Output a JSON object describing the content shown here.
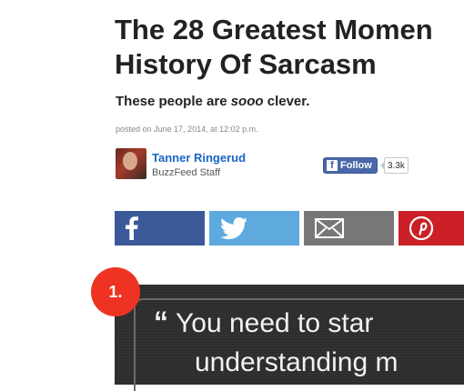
{
  "article": {
    "title_line1": "The 28 Greatest Momen",
    "title_line2": "History Of Sarcasm",
    "subtitle_before": "These people are ",
    "subtitle_emphasis": "sooo",
    "subtitle_after": " clever.",
    "posted": "posted on June 17, 2014, at 12:02 p.m."
  },
  "author": {
    "name": "Tanner Ringerud",
    "role": "BuzzFeed Staff"
  },
  "follow": {
    "logo": "f",
    "label": "Follow",
    "count": "3.3k"
  },
  "share": {
    "facebook_icon": "facebook-icon",
    "twitter_icon": "twitter-icon",
    "email_icon": "email-icon",
    "pinterest_icon": "pinterest-icon",
    "colors": {
      "facebook": "#3b5998",
      "twitter": "#5ea9dd",
      "email": "#777777",
      "pinterest": "#cb2027"
    }
  },
  "item": {
    "number": "1.",
    "quote_mark": "“",
    "quote_line1": "You need to star",
    "quote_line2": "understanding m"
  }
}
